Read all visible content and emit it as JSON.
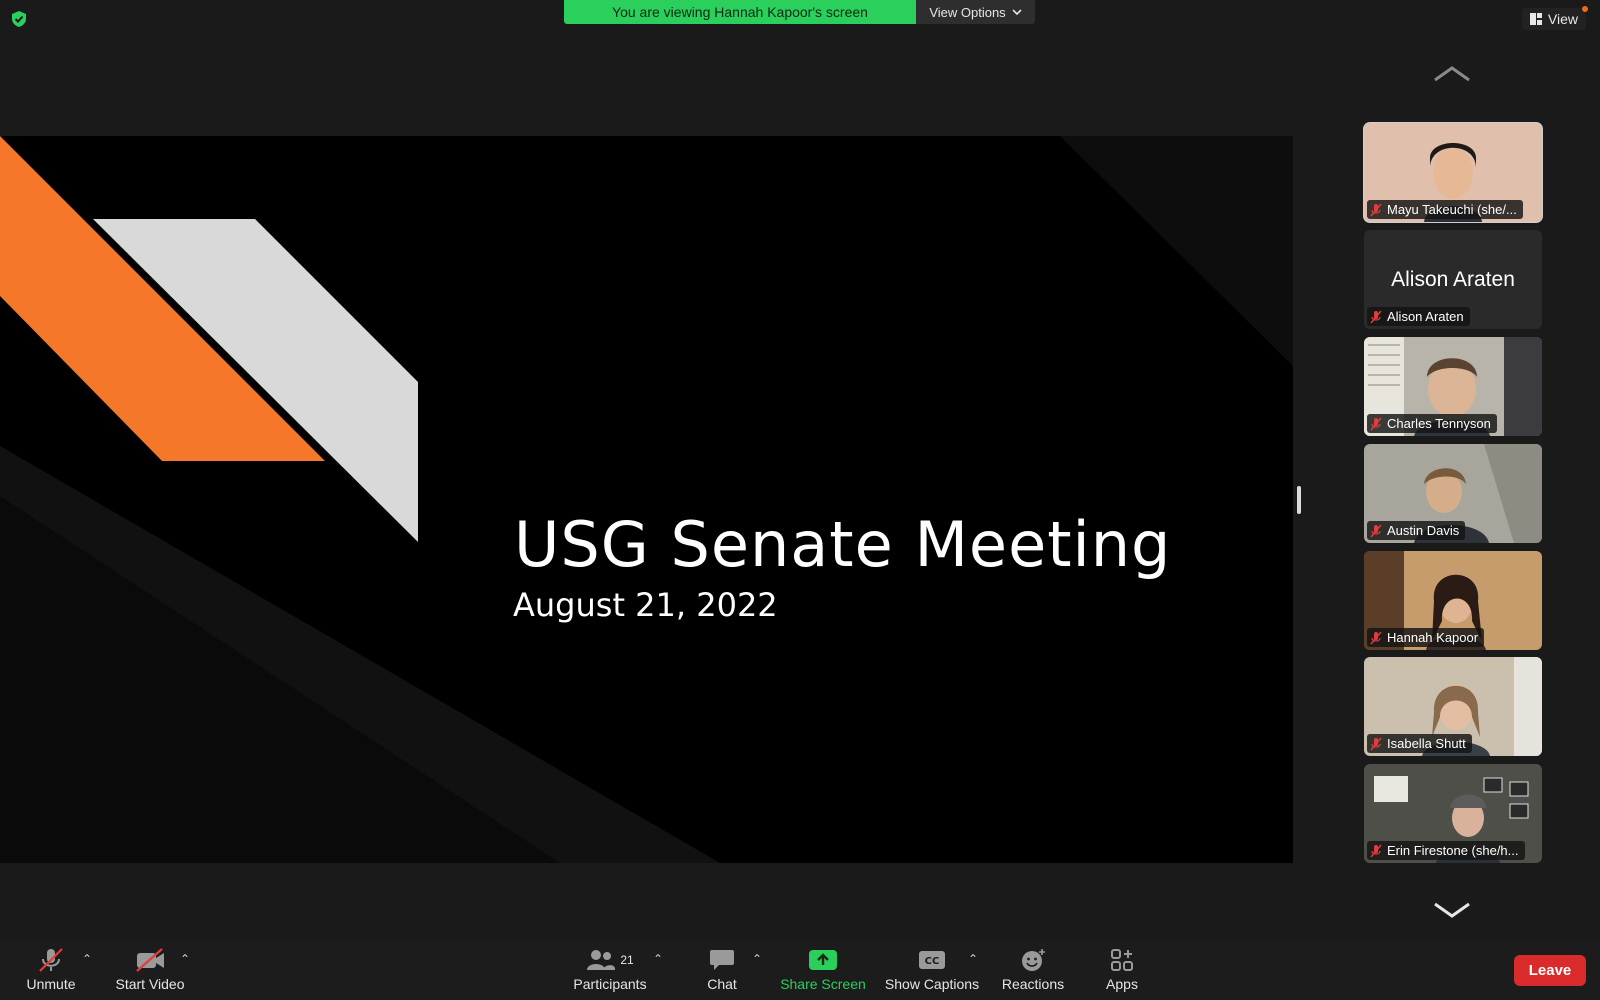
{
  "banner": {
    "text": "You are viewing Hannah Kapoor's screen",
    "options_label": "View Options"
  },
  "view_button": {
    "label": "View"
  },
  "slide": {
    "title": "USG Senate Meeting",
    "date": "August 21, 2022",
    "colors": {
      "orange": "#f5772a",
      "gray": "#d9d9d9",
      "background": "#000000"
    }
  },
  "participants_gallery": [
    {
      "name": "Mayu Takeuchi (she/...",
      "muted": true,
      "video": true
    },
    {
      "name": "Alison Araten",
      "display_name": "Alison Araten",
      "muted": true,
      "video": false
    },
    {
      "name": "Charles Tennyson",
      "muted": true,
      "video": true
    },
    {
      "name": "Austin Davis",
      "muted": true,
      "video": true
    },
    {
      "name": "Hannah Kapoor",
      "muted": true,
      "video": true
    },
    {
      "name": "Isabella Shutt",
      "muted": true,
      "video": true
    },
    {
      "name": "Erin Firestone (she/h...",
      "muted": true,
      "video": true
    }
  ],
  "toolbar": {
    "unmute": "Unmute",
    "start_video": "Start Video",
    "participants": "Participants",
    "participants_count": "21",
    "chat": "Chat",
    "share_screen": "Share Screen",
    "show_captions": "Show Captions",
    "reactions": "Reactions",
    "apps": "Apps",
    "leave": "Leave"
  },
  "colors": {
    "accent_green": "#2ad05b",
    "leave_red": "#d92b2b",
    "background": "#1a1a1a"
  }
}
